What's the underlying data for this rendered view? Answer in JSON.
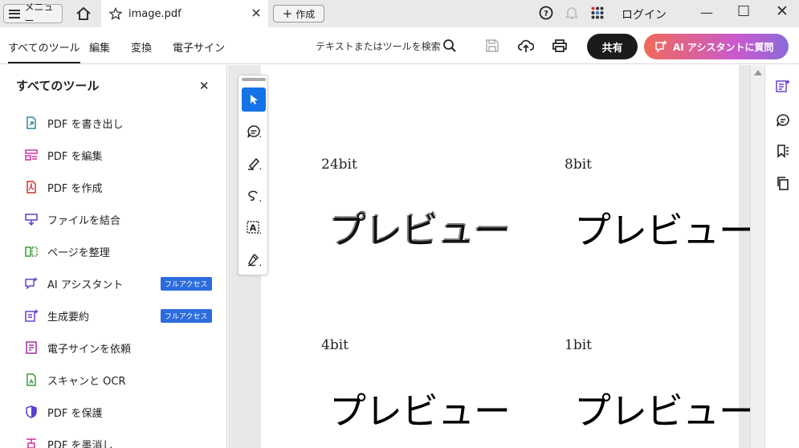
{
  "titlebar": {
    "menu_label": "メニュー",
    "tab_title": "image.pdf",
    "new_label": "作成",
    "login_label": "ログイン"
  },
  "toolbar": {
    "menus": [
      "すべてのツール",
      "編集",
      "変換",
      "電子サイン"
    ],
    "search_label": "テキストまたはツールを検索",
    "share_label": "共有",
    "ai_label": "AI アシスタントに質問"
  },
  "sidebar": {
    "title": "すべてのツール",
    "items": [
      {
        "label": "PDF を書き出し",
        "icon": "export-pdf-icon",
        "color": "#2a8a9a"
      },
      {
        "label": "PDF を編集",
        "icon": "edit-pdf-icon",
        "color": "#d0309a"
      },
      {
        "label": "PDF を作成",
        "icon": "create-pdf-icon",
        "color": "#d03030"
      },
      {
        "label": "ファイルを結合",
        "icon": "combine-files-icon",
        "color": "#5a3fd0"
      },
      {
        "label": "ページを整理",
        "icon": "organize-pages-icon",
        "color": "#3a9a3a"
      },
      {
        "label": "AI アシスタント",
        "icon": "ai-assistant-icon",
        "color": "#6a40d0",
        "badge": "フルアクセス"
      },
      {
        "label": "生成要約",
        "icon": "summary-icon",
        "color": "#6a40d0",
        "badge": "フルアクセス"
      },
      {
        "label": "電子サインを依頼",
        "icon": "request-signature-icon",
        "color": "#a030a0"
      },
      {
        "label": "スキャンと OCR",
        "icon": "scan-ocr-icon",
        "color": "#3a9a3a"
      },
      {
        "label": "PDF を保護",
        "icon": "protect-pdf-icon",
        "color": "#5a3fd0"
      },
      {
        "label": "PDF を墨消し",
        "icon": "redact-pdf-icon",
        "color": "#d0309a"
      }
    ]
  },
  "document": {
    "cells": [
      {
        "label": "24bit",
        "preview": "プレビュー",
        "style": "noisy"
      },
      {
        "label": "8bit",
        "preview": "プレビュー",
        "style": "clean"
      },
      {
        "label": "4bit",
        "preview": "プレビュー",
        "style": "clean"
      },
      {
        "label": "1bit",
        "preview": "プレビュー",
        "style": "clean"
      }
    ]
  },
  "colors": {
    "accent": "#1473e6",
    "share": "#1b1b1b",
    "badge": "#2d6cdf"
  }
}
